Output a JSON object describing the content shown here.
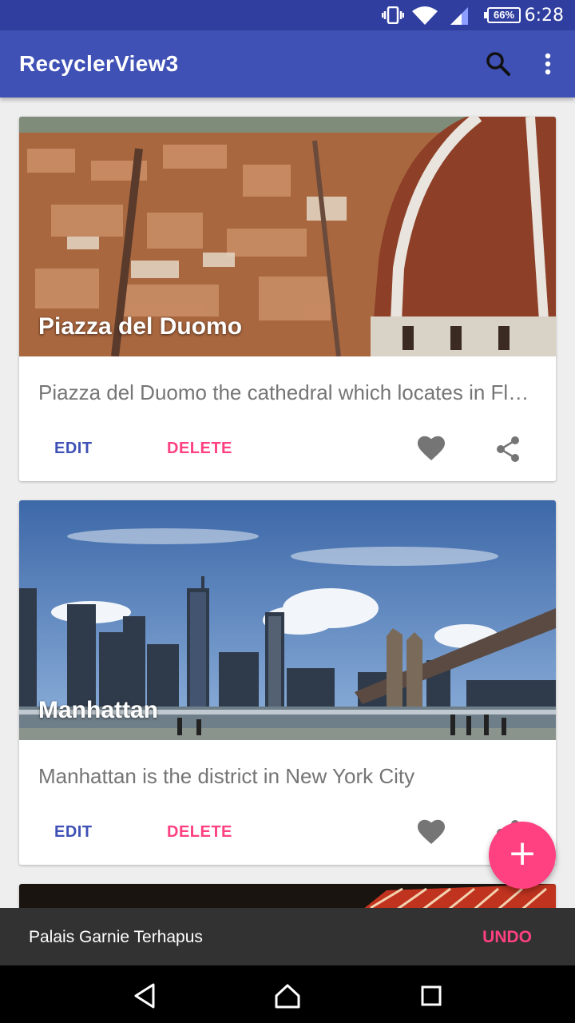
{
  "status_bar": {
    "time": "6:28",
    "battery": "66%"
  },
  "app_bar": {
    "title": "RecyclerView3",
    "icons": [
      "search-icon",
      "more-vert-icon"
    ]
  },
  "cards": [
    {
      "title": "Piazza del Duomo",
      "description": "Piazza del Duomo the cathedral which locates in Florence",
      "edit_label": "EDIT",
      "delete_label": "DELETE"
    },
    {
      "title": "Manhattan",
      "description": "Manhattan is the district in New York City",
      "edit_label": "EDIT",
      "delete_label": "DELETE"
    }
  ],
  "fab": {
    "label": "+"
  },
  "snackbar": {
    "message": "Palais Garnie Terhapus",
    "action": "UNDO"
  },
  "colors": {
    "primary": "#3f51b5",
    "primary_dark": "#303f9f",
    "accent": "#ff4081"
  }
}
